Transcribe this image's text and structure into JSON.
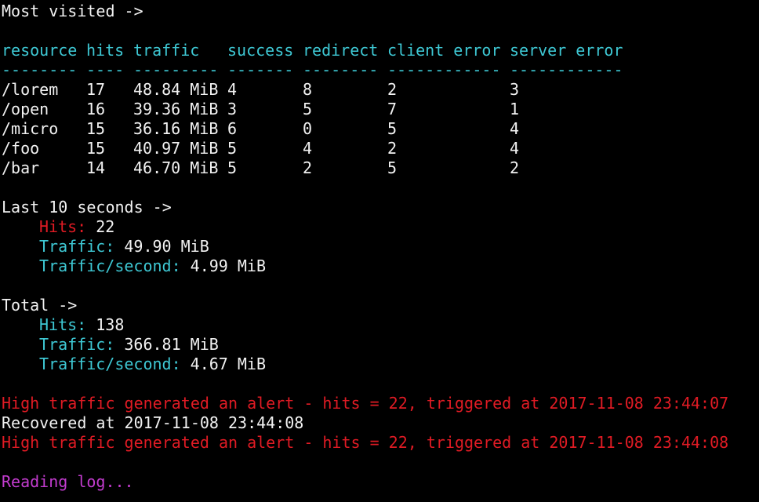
{
  "colors": {
    "background": "#000000",
    "text": "#f2f2f2",
    "cyan": "#3ec8d4",
    "red": "#e01b24",
    "magenta": "#c33ccf"
  },
  "most_visited": {
    "heading": "Most visited ->",
    "columns": [
      "resource",
      "hits",
      "traffic",
      "success",
      "redirect",
      "client error",
      "server error"
    ],
    "separators": [
      "--------",
      "----",
      "---------",
      "-------",
      "--------",
      "------------",
      "------------"
    ],
    "rows": [
      [
        "/lorem",
        "17",
        "48.84 MiB",
        "4",
        "8",
        "2",
        "3"
      ],
      [
        "/open",
        "16",
        "39.36 MiB",
        "3",
        "5",
        "7",
        "1"
      ],
      [
        "/micro",
        "15",
        "36.16 MiB",
        "6",
        "0",
        "5",
        "4"
      ],
      [
        "/foo",
        "15",
        "40.97 MiB",
        "5",
        "4",
        "2",
        "4"
      ],
      [
        "/bar",
        "14",
        "46.70 MiB",
        "5",
        "2",
        "5",
        "2"
      ]
    ]
  },
  "last_10_seconds": {
    "heading": "Last 10 seconds ->",
    "hits_label": "Hits:",
    "hits_value": " 22",
    "traffic_label": "Traffic:",
    "traffic_value": " 49.90 MiB",
    "traffic_per_second_label": "Traffic/second:",
    "traffic_per_second_value": " 4.99 MiB"
  },
  "total": {
    "heading": "Total ->",
    "hits_label": "Hits:",
    "hits_value": " 138",
    "traffic_label": "Traffic:",
    "traffic_value": " 366.81 MiB",
    "traffic_per_second_label": "Traffic/second:",
    "traffic_per_second_value": " 4.67 MiB"
  },
  "alerts": [
    "High traffic generated an alert - hits = 22, triggered at 2017-11-08 23:44:07",
    "Recovered at 2017-11-08 23:44:08",
    "High traffic generated an alert - hits = 22, triggered at 2017-11-08 23:44:08"
  ],
  "status": "Reading log..."
}
